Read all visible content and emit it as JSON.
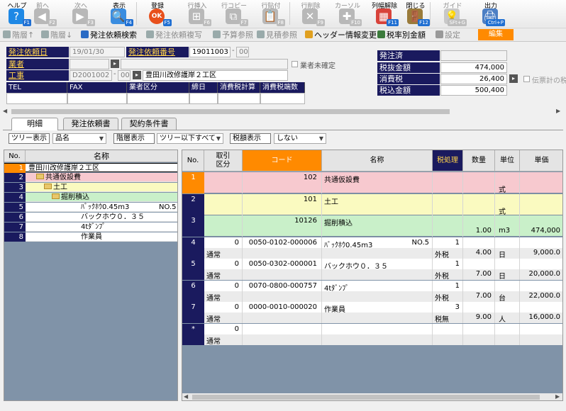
{
  "toolbar": [
    {
      "label": "ヘルプ",
      "fkey": "F1",
      "icon": "help-icon",
      "enabled": true,
      "color": "#1e88e5",
      "glyph": "?"
    },
    {
      "label": "前へ",
      "fkey": "F2",
      "icon": "arrow-left-icon",
      "enabled": false,
      "color": "#b8b8b8",
      "glyph": "◀"
    },
    {
      "label": "次へ",
      "fkey": "F3",
      "icon": "arrow-right-icon",
      "enabled": false,
      "color": "#b8b8b8",
      "glyph": "▶"
    },
    {
      "label": "表示",
      "fkey": "F4",
      "icon": "magnifier-icon",
      "enabled": true,
      "color": "#3a8de0",
      "glyph": "🔍"
    },
    {
      "label": "登録",
      "fkey": "F5",
      "icon": "ok-icon",
      "enabled": true,
      "color": "#e8501c",
      "glyph": "OK"
    },
    {
      "label": "行挿入",
      "fkey": "F6",
      "icon": "row-insert-icon",
      "enabled": false,
      "color": "#b8b8b8",
      "glyph": "⊞"
    },
    {
      "label": "行コピー",
      "fkey": "F7",
      "icon": "row-copy-icon",
      "enabled": false,
      "color": "#b8b8b8",
      "glyph": "⧉"
    },
    {
      "label": "行貼付",
      "fkey": "F8",
      "icon": "row-paste-icon",
      "enabled": false,
      "color": "#b8b8b8",
      "glyph": "📋"
    },
    {
      "label": "行削除",
      "fkey": "F9",
      "icon": "row-delete-icon",
      "enabled": false,
      "color": "#b8b8b8",
      "glyph": "✕"
    },
    {
      "label": "カーソル",
      "fkey": "F10",
      "icon": "cursor-icon",
      "enabled": false,
      "color": "#b8b8b8",
      "glyph": "✚"
    },
    {
      "label": "列幅解除",
      "fkey": "F11",
      "icon": "column-width-icon",
      "enabled": true,
      "color": "#d8433b",
      "glyph": "▦"
    },
    {
      "label": "閉じる",
      "fkey": "F12",
      "icon": "close-door-icon",
      "enabled": true,
      "color": "#9a7b3a",
      "glyph": "🚪"
    },
    {
      "label": "ガイド",
      "fkey": "SFt+G",
      "icon": "guide-bulb-icon",
      "enabled": false,
      "color": "#c8c8c8",
      "glyph": "💡"
    },
    {
      "label": "出力",
      "fkey": "Ctrl+P",
      "icon": "printer-icon",
      "enabled": true,
      "color": "#4d7fc4",
      "glyph": "🖨"
    }
  ],
  "subtoolbar": [
    {
      "label": "階層↑",
      "icon": "hierarchy-up-icon",
      "enabled": false
    },
    {
      "label": "階層↓",
      "icon": "hierarchy-down-icon",
      "enabled": false
    },
    {
      "label": "発注依頼検索",
      "icon": "order-search-icon",
      "enabled": true
    },
    {
      "label": "発注依頼複写",
      "icon": "order-copy-icon",
      "enabled": false
    },
    {
      "label": "予算参照",
      "icon": "budget-ref-icon",
      "enabled": false
    },
    {
      "label": "見積参照",
      "icon": "estimate-ref-icon",
      "enabled": false
    },
    {
      "label": "ヘッダー情報変更",
      "icon": "header-change-icon",
      "enabled": true
    },
    {
      "label": "税率別金額",
      "icon": "tax-rate-icon",
      "enabled": true
    },
    {
      "label": "設定",
      "icon": "settings-gear-icon",
      "enabled": false
    }
  ],
  "edit_badge": "編集",
  "form": {
    "order_date_label": "発注依頼日",
    "order_date": "19/01/30",
    "order_no_label": "発注依頼番号",
    "order_no": "19011003",
    "order_no_sub": "00",
    "vendor_label": "業者",
    "vendor_unconfirmed": "業者未確定",
    "work_label": "工事",
    "work_code": "D2001002",
    "work_sub": "00",
    "work_name": "豊田川改修護岸２工区",
    "columns": [
      "TEL",
      "FAX",
      "業者区分",
      "締日",
      "消費税計算",
      "消費税端数"
    ]
  },
  "summary": {
    "ordered_label": "発注済",
    "ordered_value": "",
    "pretax_label": "税抜金額",
    "pretax_value": "474,000",
    "tax_label": "消費税",
    "tax_value": "26,400",
    "total_label": "税込金額",
    "total_value": "500,400",
    "slip_tax_label": "伝票計の税"
  },
  "tabs": [
    "明細",
    "発注依頼書",
    "契約条件書"
  ],
  "filters": {
    "tree_display_label": "ツリー表示",
    "tree_display_value": "品名",
    "level_display_label": "階層表示",
    "level_display_value": "ツリー以下すべて",
    "tax_display_label": "税額表示",
    "tax_display_value": "しない"
  },
  "tree": {
    "header_no": "No.",
    "header_name": "名称",
    "rows": [
      {
        "no": "1",
        "name": "豊田川改修護岸２工区",
        "suffix": "",
        "indent": 0,
        "folder": false,
        "bg": "#ffffff"
      },
      {
        "no": "2",
        "name": "共通仮設費",
        "suffix": "",
        "indent": 1,
        "folder": true,
        "bg": "#f7c9cf"
      },
      {
        "no": "3",
        "name": "土工",
        "suffix": "",
        "indent": 2,
        "folder": true,
        "bg": "#fafac0"
      },
      {
        "no": "4",
        "name": "掘削積込",
        "suffix": "",
        "indent": 3,
        "folder": true,
        "bg": "#c9f0c9"
      },
      {
        "no": "5",
        "name": "ﾊﾞｯｸﾎｳ0.45m3",
        "suffix": "NO.5",
        "indent": 4,
        "folder": false,
        "bg": "#ffffff"
      },
      {
        "no": "6",
        "name": "バックホウ０．３５",
        "suffix": "",
        "indent": 4,
        "folder": false,
        "bg": "#ffffff"
      },
      {
        "no": "7",
        "name": "4tﾀﾞﾝﾌﾟ",
        "suffix": "",
        "indent": 4,
        "folder": false,
        "bg": "#ffffff"
      },
      {
        "no": "8",
        "name": "作業員",
        "suffix": "",
        "indent": 4,
        "folder": false,
        "bg": "#ffffff"
      }
    ]
  },
  "grid": {
    "headers": {
      "no": "No.",
      "kubun1": "取引",
      "kubun2": "区分",
      "code": "コード",
      "name": "名称",
      "tax": "税処理",
      "qty": "数量",
      "unit": "単位",
      "price": "単価"
    },
    "rows": [
      {
        "no": "1",
        "kubun": "",
        "kubun2": "",
        "code": "102",
        "code2": "",
        "name": "共通仮設費",
        "name_r": "",
        "tax1": "",
        "tax2": "",
        "qty": "",
        "unit": "式",
        "price": "",
        "bg": "#f7c9cf"
      },
      {
        "no": "2",
        "kubun": "",
        "kubun2": "",
        "code": "101",
        "code2": "",
        "name": "土工",
        "name_r": "",
        "tax1": "",
        "tax2": "",
        "qty": "",
        "unit": "式",
        "price": "",
        "bg": "#fafac0"
      },
      {
        "no": "3",
        "kubun": "",
        "kubun2": "",
        "code": "10126",
        "code2": "",
        "name": "掘削積込",
        "name_r": "",
        "tax1": "",
        "tax2": "",
        "qty": "1.00",
        "unit": "m3",
        "price": "474,000",
        "bg": "#c9f0c9"
      },
      {
        "no": "4",
        "kubun": "0",
        "kubun2": "通常",
        "code": "0050-0102-000006",
        "code2": "",
        "name": "ﾊﾞｯｸﾎｳ0.45m3",
        "name_r": "NO.5",
        "tax1": "1",
        "tax2": "外税",
        "qty": "4.00",
        "unit": "日",
        "price": "9,000.0",
        "bg": "#ffffff"
      },
      {
        "no": "5",
        "kubun": "0",
        "kubun2": "通常",
        "code": "0050-0302-000001",
        "code2": "",
        "name": "バックホウ０．３５",
        "name_r": "",
        "tax1": "1",
        "tax2": "外税",
        "qty": "7.00",
        "unit": "日",
        "price": "20,000.0",
        "bg": "#ffffff"
      },
      {
        "no": "6",
        "kubun": "0",
        "kubun2": "通常",
        "code": "0070-0800-000757",
        "code2": "",
        "name": "4tﾀﾞﾝﾌﾟ",
        "name_r": "",
        "tax1": "1",
        "tax2": "外税",
        "qty": "7.00",
        "unit": "台",
        "price": "22,000.0",
        "bg": "#ffffff"
      },
      {
        "no": "7",
        "kubun": "0",
        "kubun2": "通常",
        "code": "0000-0010-000020",
        "code2": "",
        "name": "作業員",
        "name_r": "",
        "tax1": "3",
        "tax2": "税無",
        "qty": "9.00",
        "unit": "人",
        "price": "16,000.0",
        "bg": "#ffffff"
      },
      {
        "no": "*",
        "kubun": "0",
        "kubun2": "通常",
        "code": "",
        "code2": "",
        "name": "",
        "name_r": "",
        "tax1": "",
        "tax2": "",
        "qty": "",
        "unit": "",
        "price": "",
        "bg": "#ffffff"
      }
    ]
  }
}
